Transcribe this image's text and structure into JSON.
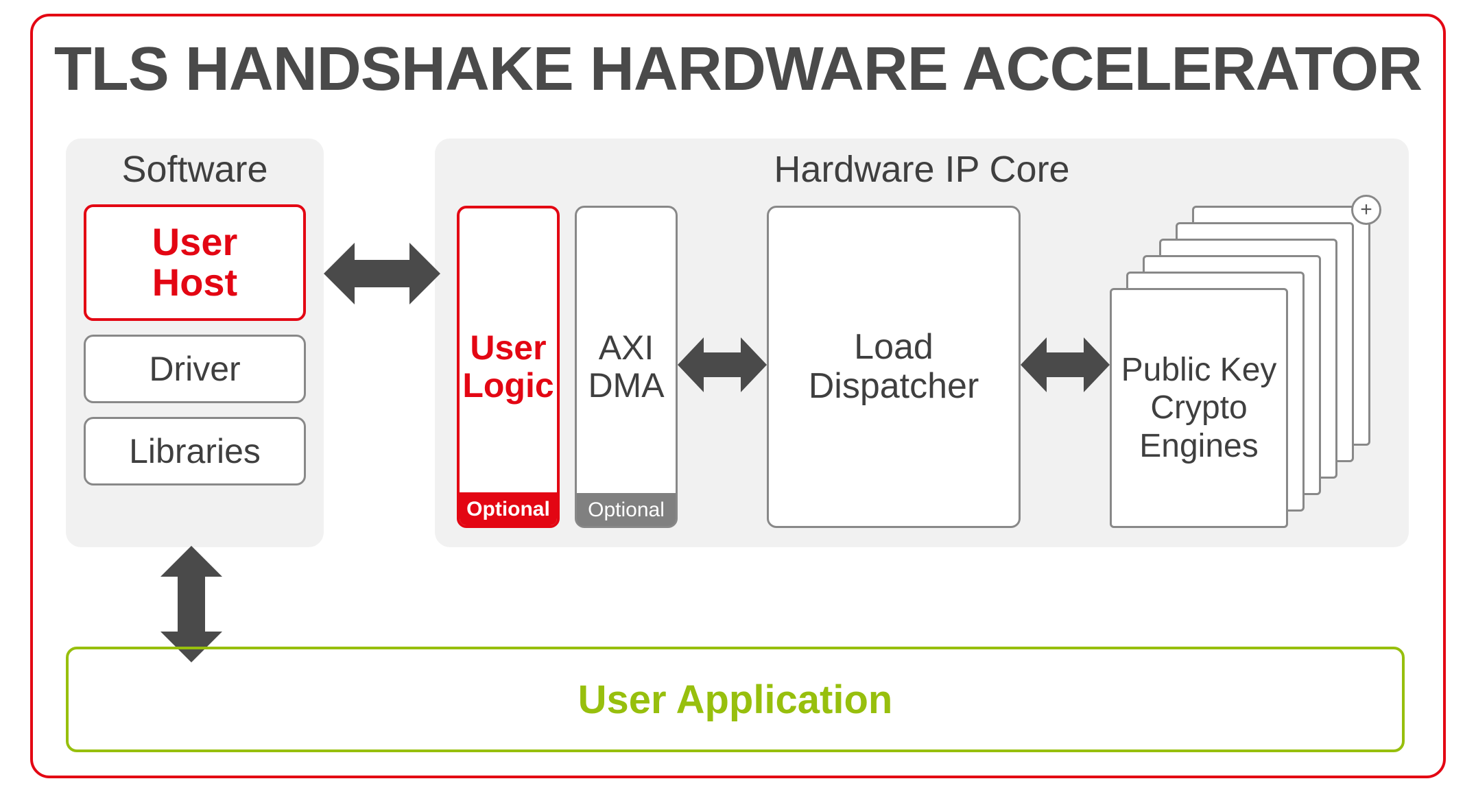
{
  "title": "TLS HANDSHAKE HARDWARE ACCELERATOR",
  "software": {
    "label": "Software",
    "user_host": "User\nHost",
    "driver": "Driver",
    "libraries": "Libraries"
  },
  "hardware": {
    "label": "Hardware IP Core",
    "user_logic": "User\nLogic",
    "user_logic_optional": "Optional",
    "axi_dma": "AXI\nDMA",
    "axi_dma_optional": "Optional",
    "load_dispatcher": "Load\nDispatcher",
    "crypto_engines": "Public Key\nCrypto\nEngines",
    "plus": "+"
  },
  "user_application": "User Application"
}
